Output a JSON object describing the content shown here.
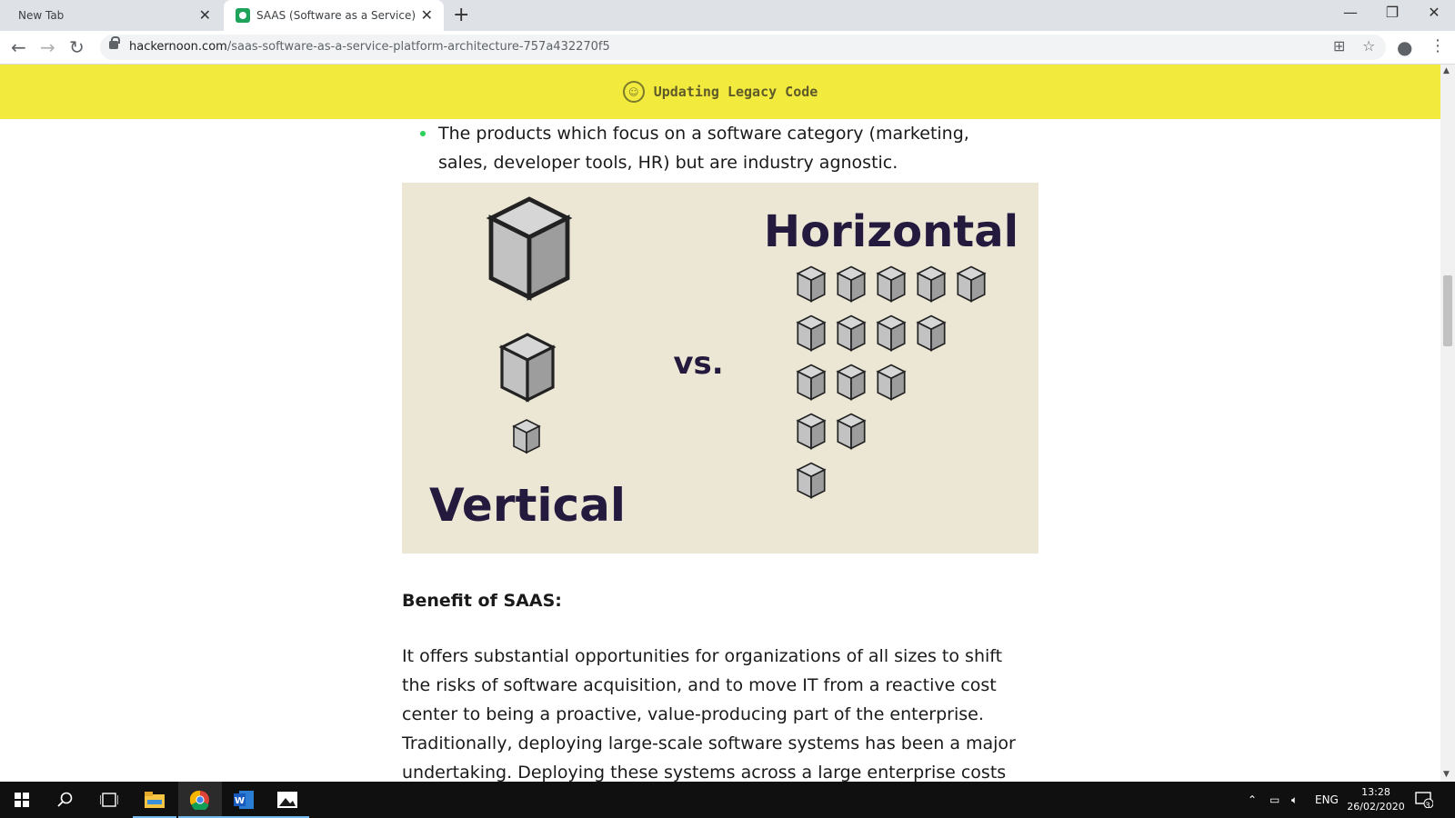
{
  "browser": {
    "tabs": [
      {
        "title": "New Tab",
        "active": false
      },
      {
        "title": "SAAS (Software as a Service) Plat",
        "active": true
      }
    ],
    "url_host": "hackernoon.com",
    "url_path": "/saas-software-as-a-service-platform-architecture-757a432270f5"
  },
  "banner": {
    "label": "Updating Legacy Code"
  },
  "article": {
    "bullet": "The products which focus on a software category (marketing, sales, developer tools, HR) but are industry agnostic.",
    "figure": {
      "vertical_label": "Vertical",
      "vs_label": "vs.",
      "horizontal_label": "Horizontal"
    },
    "heading": "Benefit of SAAS:",
    "paragraph": "It offers substantial opportunities for organizations of all sizes to shift the risks of software acquisition, and to move IT from a reactive cost center to being a proactive, value-producing part of the enterprise. Traditionally, deploying large-scale software systems has been a major undertaking. Deploying these systems across a large enterprise costs more. The time, staff"
  },
  "taskbar": {
    "language": "ENG",
    "time": "13:28",
    "date": "26/02/2020",
    "notification_count": "3"
  },
  "colors": {
    "banner_bg": "#f3ea3e",
    "figure_bg": "#ece7d5",
    "figure_text": "#231a3e",
    "bullet_dot": "#2bd25a"
  }
}
